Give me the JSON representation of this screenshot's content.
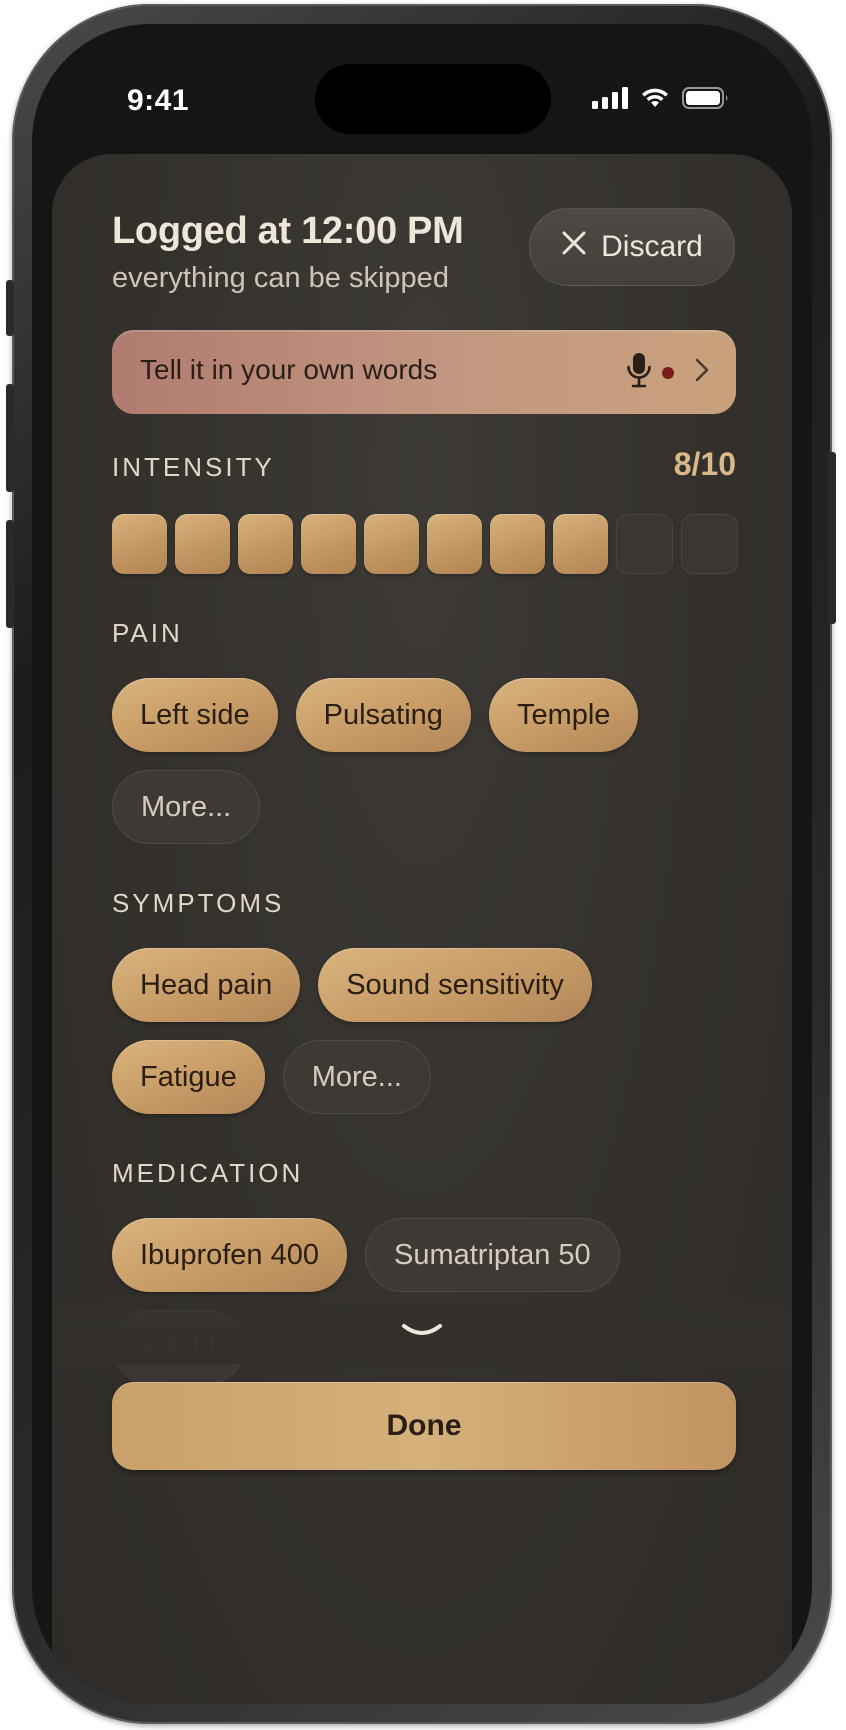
{
  "status_bar": {
    "time": "9:41"
  },
  "header": {
    "title": "Logged at 12:00 PM",
    "subtitle": "everything can be skipped",
    "discard_label": "Discard"
  },
  "voice_entry": {
    "label": "Tell it in your own words",
    "icons": [
      "mic-icon",
      "recording-dot",
      "chevron-right-icon"
    ]
  },
  "intensity": {
    "label": "INTENSITY",
    "value_text": "8/10",
    "value": 8,
    "max": 10
  },
  "pain": {
    "label": "PAIN",
    "chips": [
      {
        "label": "Left side",
        "selected": true
      },
      {
        "label": "Pulsating",
        "selected": true
      },
      {
        "label": "Temple",
        "selected": true
      },
      {
        "label": "More...",
        "selected": false
      }
    ]
  },
  "symptoms": {
    "label": "SYMPTOMS",
    "chips": [
      {
        "label": "Head pain",
        "selected": true
      },
      {
        "label": "Sound sensitivity",
        "selected": true
      },
      {
        "label": "Fatigue",
        "selected": true
      },
      {
        "label": "More...",
        "selected": false
      }
    ]
  },
  "medication": {
    "label": "MEDICATION",
    "chips": [
      {
        "label": "Ibuprofen 400",
        "selected": true
      },
      {
        "label": "Sumatriptan 50",
        "selected": false
      }
    ],
    "add_label": "+ Add"
  },
  "footer": {
    "done_label": "Done"
  },
  "colors": {
    "accent_gold": "#c9a06a",
    "sheet_background": "#33302c",
    "voice_gradient_start": "#b07b70",
    "recording_dot": "#7a1b1b"
  }
}
